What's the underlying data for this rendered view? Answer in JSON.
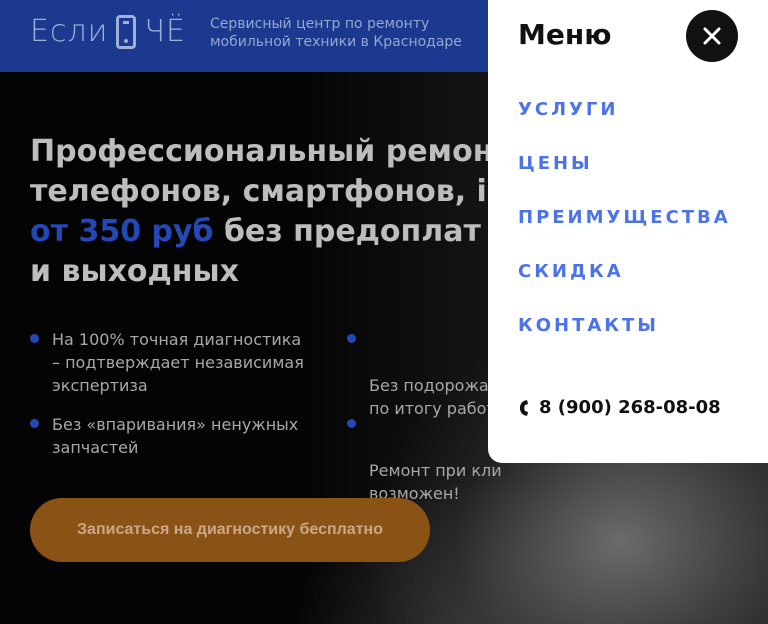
{
  "header": {
    "logo_left": "Если",
    "logo_right": "ЧЁ",
    "tagline": "Сервисный центр по ремонту мобильной техники в Краснодаре"
  },
  "hero": {
    "title_line1": "Профессиональный ремонт",
    "title_line2": "телефонов, смартфонов, iPh",
    "title_line3_accent": "от 350 руб",
    "title_line3_rest": " без предоплат",
    "title_line4": "и выходных",
    "bullets": [
      {
        "text": "На 100% точная диагностика – подтверждает независимая экспертиза"
      },
      {
        "text": "Без подорожан\nпо итогу работ"
      },
      {
        "text": "Без «впаривания» ненужных запчастей"
      },
      {
        "text": "Ремонт при кли\nвозможен!"
      }
    ],
    "cta_label": "Записаться на диагностику бесплатно"
  },
  "menu": {
    "title": "Меню",
    "items": [
      {
        "label": "УСЛУГИ"
      },
      {
        "label": "ЦЕНЫ"
      },
      {
        "label": "ПРЕИМУЩЕСТВА"
      },
      {
        "label": "СКИДКА"
      },
      {
        "label": "КОНТАКТЫ"
      }
    ],
    "phone": "8 (900) 268-08-08"
  },
  "colors": {
    "header_bg": "#1b3a8f",
    "accent_blue": "#2448b5",
    "menu_link": "#4c74e8",
    "cta_bg": "#8a5315"
  },
  "icons": {
    "close": "close-icon",
    "phone": "phone-icon",
    "logo_phone": "phone-logo-icon"
  }
}
